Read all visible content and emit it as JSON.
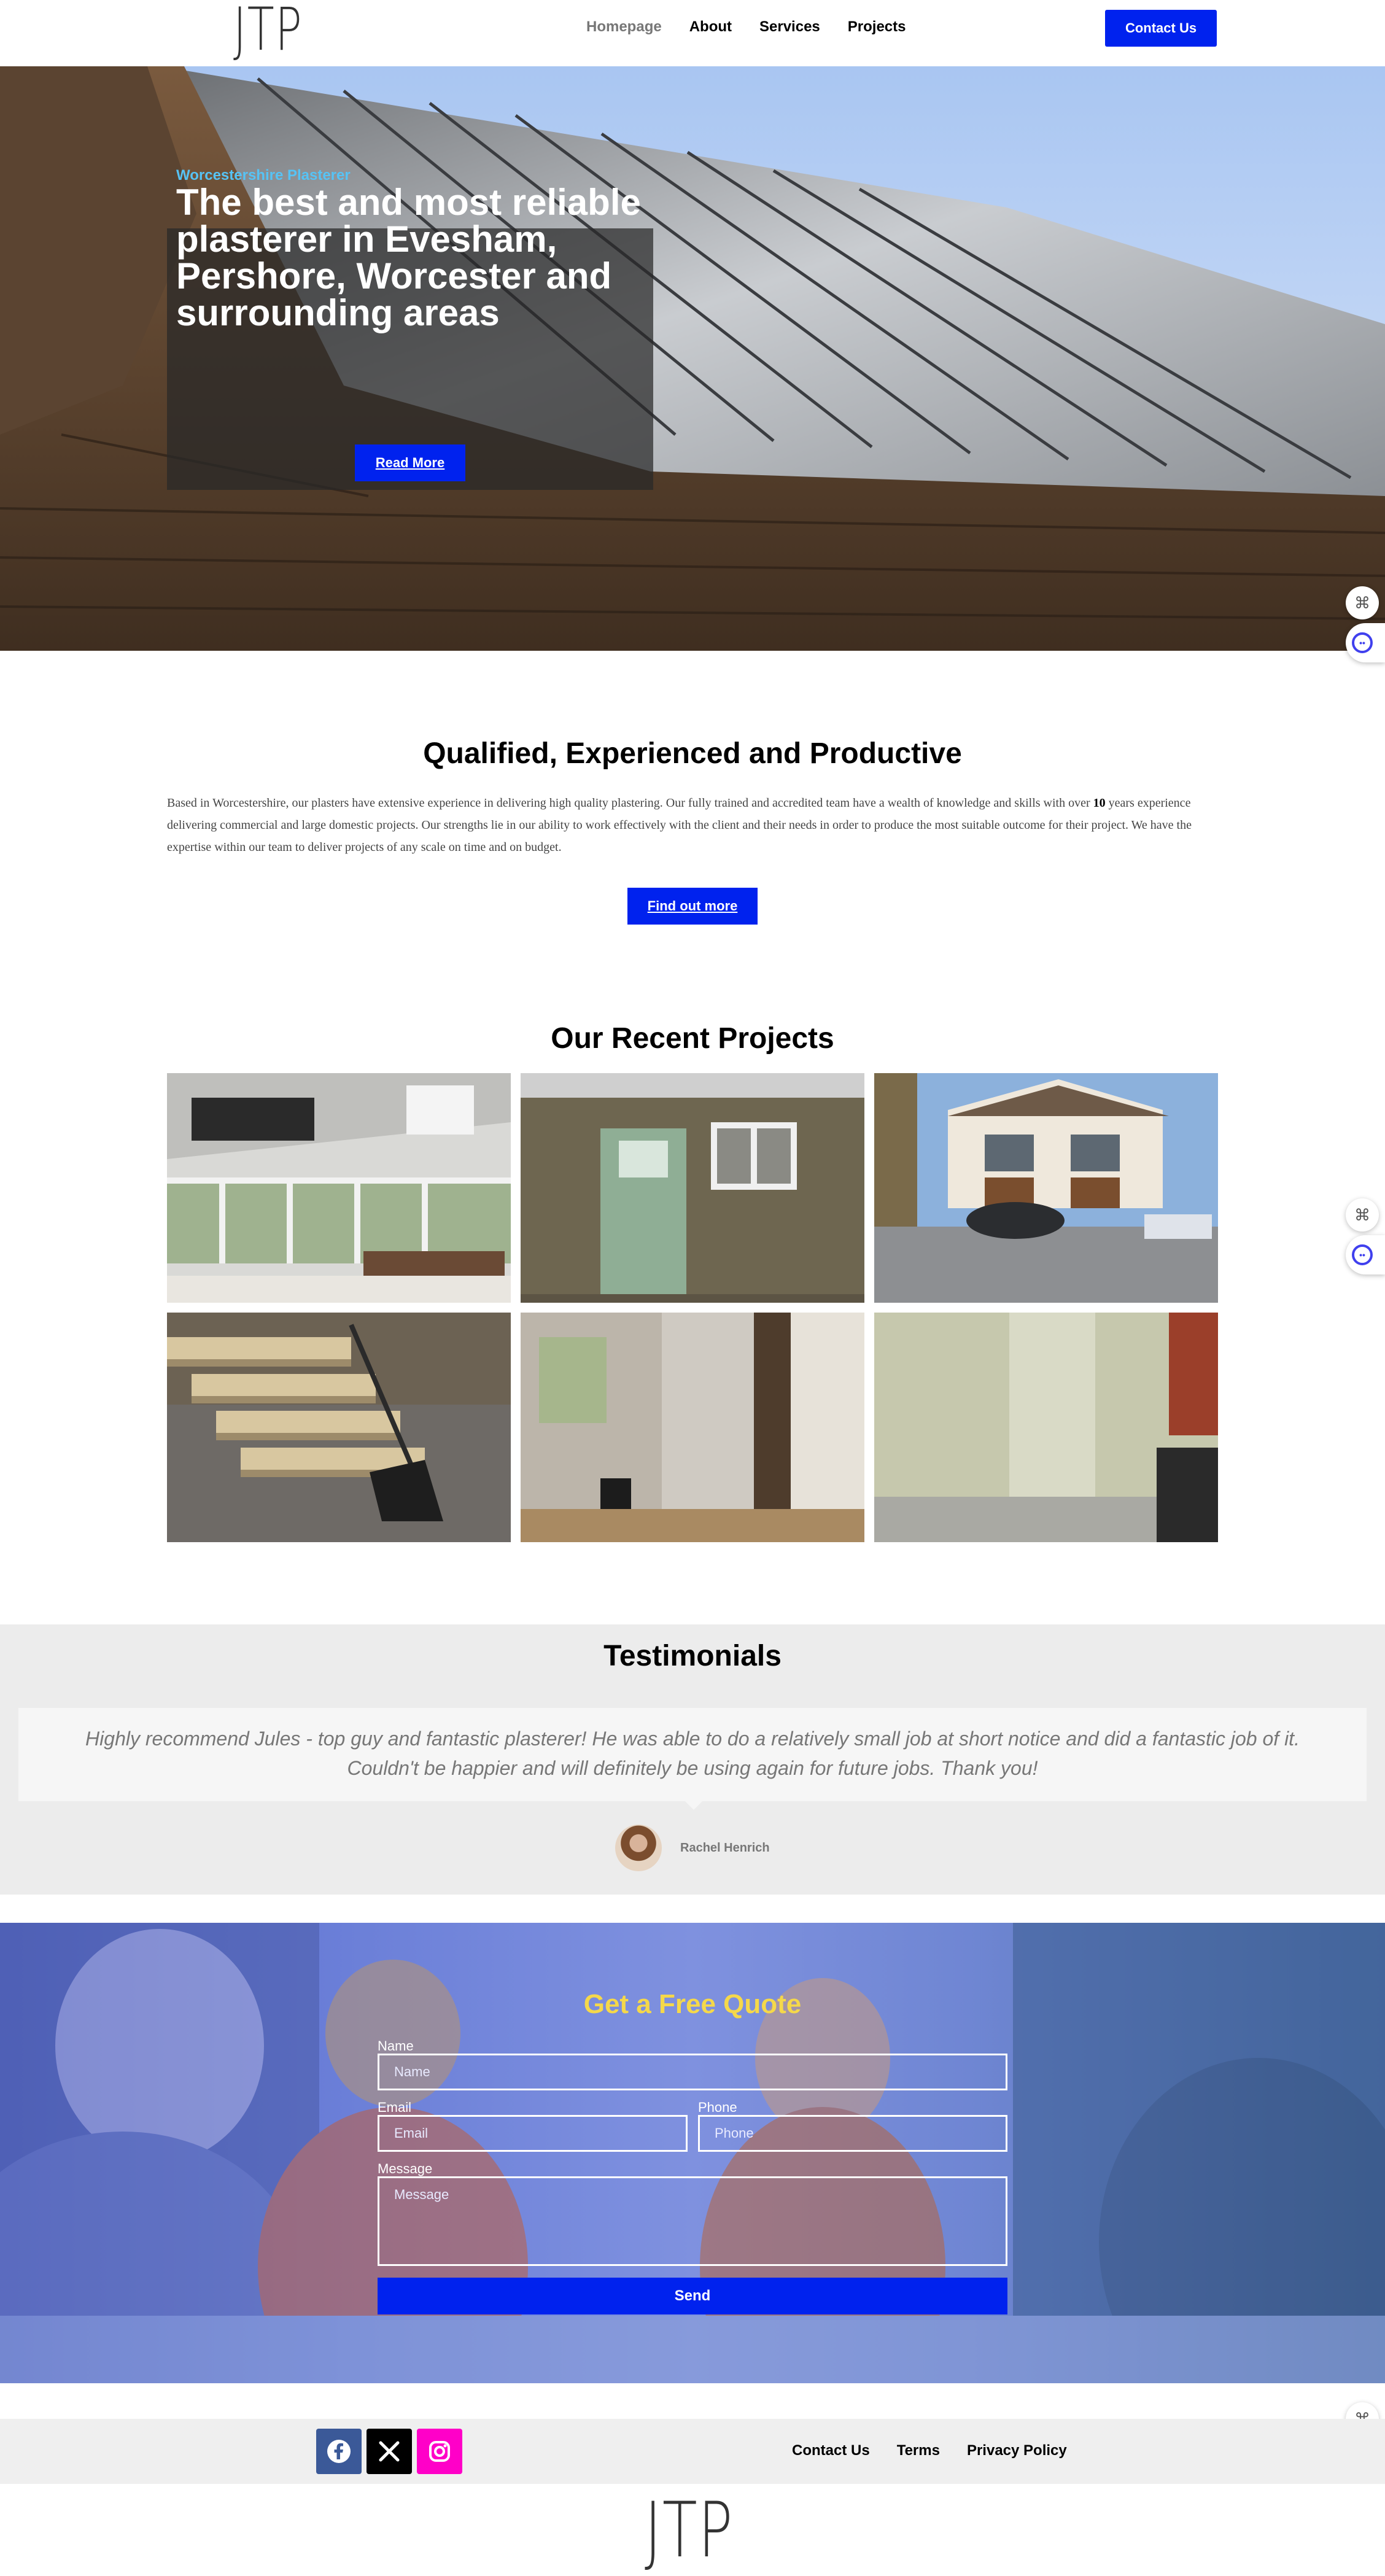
{
  "header": {
    "logo": "JTP",
    "nav": [
      "Homepage",
      "About",
      "Services",
      "Projects"
    ],
    "active_nav": "Homepage",
    "cta": "Contact Us"
  },
  "hero": {
    "eyebrow": "Worcestershire Plasterer",
    "title": "The best and most reliable plasterer in Evesham, Pershore, Worcester and surrounding areas",
    "button": "Read More"
  },
  "qualified": {
    "title": "Qualified, Experienced and Productive",
    "text_before_bold": "Based in Worcestershire, our plasters have extensive experience in delivering high quality plastering. Our fully trained and accredited team have a wealth of knowledge and skills with over",
    "bold": "10",
    "text_after_bold": "years experience delivering commercial and large domestic projects. Our strengths lie in our ability to work effectively with the client and their needs in order to produce the most suitable outcome for their project. We have the expertise within our team to deliver projects of any scale on time and on budget.",
    "button": "Find out more"
  },
  "projects": {
    "title": "Our Recent Projects"
  },
  "testimonials": {
    "title": "Testimonials",
    "quote": "Highly recommend Jules - top guy and fantastic plasterer! He was able to do a relatively small job at short notice and did a fantastic job of it. Couldn't be happier and will definitely be using again for future jobs. Thank you!",
    "author": "Rachel Henrich"
  },
  "quote_form": {
    "title": "Get a Free Quote",
    "name_label": "Name",
    "name_placeholder": "Name",
    "email_label": "Email",
    "email_placeholder": "Email",
    "phone_label": "Phone",
    "phone_placeholder": "Phone",
    "message_label": "Message",
    "message_placeholder": "Message",
    "submit": "Send"
  },
  "footer": {
    "social": [
      "facebook-icon",
      "x-icon",
      "instagram-icon"
    ],
    "links": [
      "Contact Us",
      "Terms",
      "Privacy Policy"
    ],
    "logo": "JTP"
  },
  "colors": {
    "accent": "#0022ee",
    "eyebrow": "#56c3f5",
    "quote_title": "#f5d84a",
    "facebook": "#3b5998",
    "x": "#000000",
    "instagram": "#ff00c8"
  }
}
